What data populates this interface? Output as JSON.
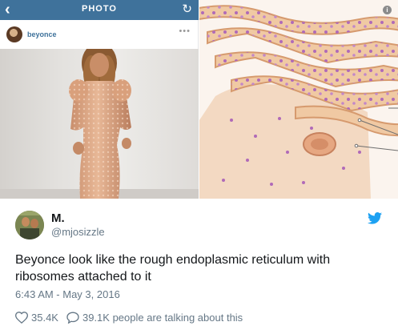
{
  "phone": {
    "title": "PHOTO",
    "back_icon": "chevron-left-icon",
    "refresh_icon": "refresh-icon",
    "username": "beyonce",
    "more": "•••",
    "bar_color": "#3f729b"
  },
  "diagram": {
    "info_icon": "info-icon"
  },
  "tweet": {
    "display_name": "M.",
    "handle": "@mjosizzle",
    "text": "Beyonce look like the rough endoplasmic reticulum with ribosomes attached to it",
    "timestamp": "6:43 AM - May 3, 2016",
    "likes": "35.4K",
    "talking": "39.1K people are talking about this",
    "brand_color": "#1da1f2",
    "heart_icon": "heart-icon",
    "comment_icon": "speech-bubble-icon",
    "logo_icon": "twitter-bird-icon"
  }
}
